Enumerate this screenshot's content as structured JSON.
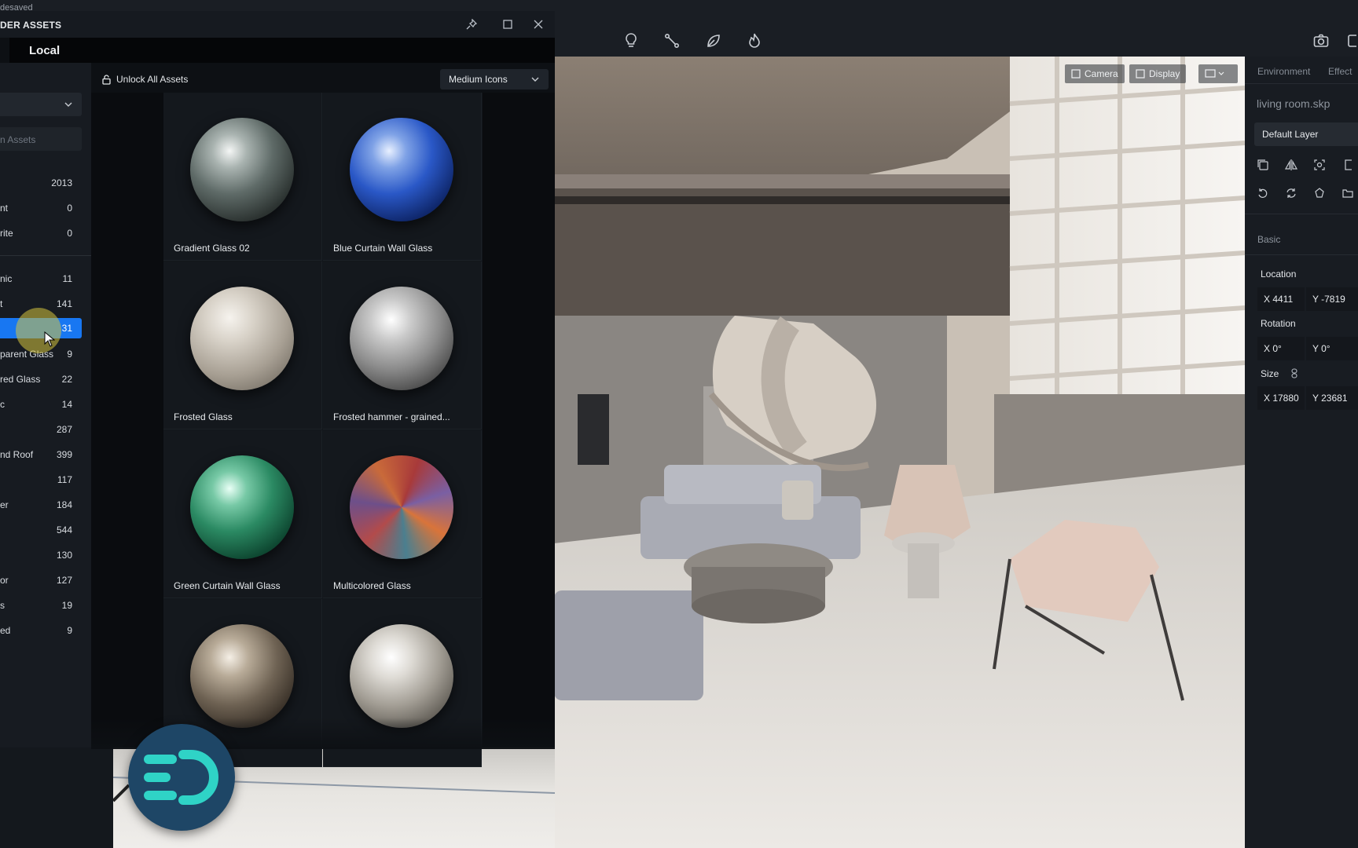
{
  "app": {
    "top_crumb": "desaved"
  },
  "toolbar": {
    "icons": [
      "bulb-icon",
      "measure-icon",
      "leaf-icon",
      "flame-icon"
    ],
    "right_icons": [
      "camera-icon",
      "panel-icon"
    ]
  },
  "assets_panel": {
    "title": "DER ASSETS",
    "tab": "Local",
    "unlock_label": "Unlock All Assets",
    "view_mode": "Medium Icons",
    "search_placeholder": "n Assets",
    "categories": [
      {
        "name": "",
        "count": "2013"
      },
      {
        "name": "nt",
        "count": "0"
      },
      {
        "name": "rite",
        "count": "0"
      },
      {
        "name": "nic",
        "count": "11"
      },
      {
        "name": "t",
        "count": "141"
      },
      {
        "name": "",
        "count": "31",
        "selected": true
      },
      {
        "name": "parent Glass",
        "count": "9"
      },
      {
        "name": "red Glass",
        "count": "22"
      },
      {
        "name": "c",
        "count": "14"
      },
      {
        "name": "",
        "count": "287"
      },
      {
        "name": "nd Roof",
        "count": "399"
      },
      {
        "name": "",
        "count": "117"
      },
      {
        "name": "er",
        "count": "184"
      },
      {
        "name": "",
        "count": "544"
      },
      {
        "name": "",
        "count": "130"
      },
      {
        "name": "or",
        "count": "127"
      },
      {
        "name": "s",
        "count": "19"
      },
      {
        "name": "ed",
        "count": "9"
      }
    ],
    "materials": [
      {
        "label": "Gradient Glass 02"
      },
      {
        "label": "Blue Curtain Wall Glass"
      },
      {
        "label": "Frosted Glass"
      },
      {
        "label": "Frosted hammer - grained..."
      },
      {
        "label": "Green Curtain Wall Glass"
      },
      {
        "label": "Multicolored Glass"
      },
      {
        "label": ""
      },
      {
        "label": ""
      }
    ]
  },
  "viewport": {
    "camera_label": "Camera",
    "display_label": "Display"
  },
  "right_panel": {
    "tabs": [
      "Environment",
      "Effect"
    ],
    "file_name": "living room.skp",
    "layer": "Default Layer",
    "section_basic": "Basic",
    "location_label": "Location",
    "location_x": "X 4411",
    "location_y": "Y -7819",
    "rotation_label": "Rotation",
    "rotation_x": "X 0°",
    "rotation_y": "Y 0°",
    "size_label": "Size",
    "size_x": "X 17880",
    "size_y": "Y 23681"
  },
  "colors": {
    "accent": "#1877f2",
    "panel_bg": "#0d1014",
    "logo_ring": "#1e4666",
    "logo_glyph": "#2fd3c6"
  }
}
